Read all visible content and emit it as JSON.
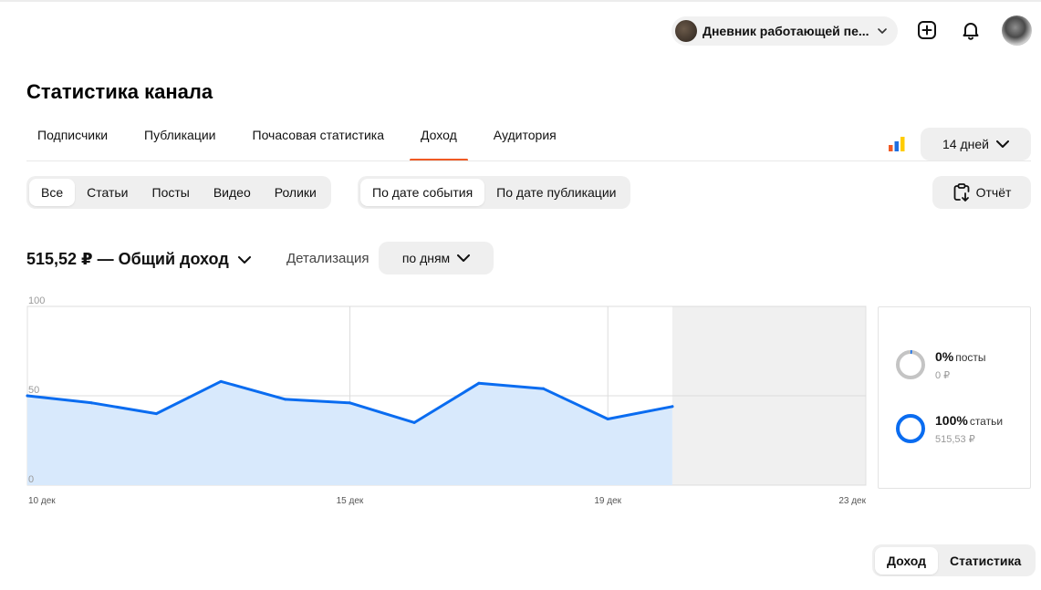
{
  "header": {
    "channel_name": "Дневник работающей пе...",
    "icons": [
      "add-icon",
      "bell-icon"
    ]
  },
  "page_title": "Статистика канала",
  "tabs": [
    {
      "label": "Подписчики",
      "active": false
    },
    {
      "label": "Публикации",
      "active": false
    },
    {
      "label": "Почасовая статистика",
      "active": false
    },
    {
      "label": "Доход",
      "active": true
    },
    {
      "label": "Аудитория",
      "active": false
    }
  ],
  "period": {
    "label": "14 дней"
  },
  "content_filter": [
    {
      "label": "Все",
      "active": true
    },
    {
      "label": "Статьи",
      "active": false
    },
    {
      "label": "Посты",
      "active": false
    },
    {
      "label": "Видео",
      "active": false
    },
    {
      "label": "Ролики",
      "active": false
    }
  ],
  "date_filter": [
    {
      "label": "По дате события",
      "active": true
    },
    {
      "label": "По дате публикации",
      "active": false
    }
  ],
  "report_button": {
    "label": "Отчёт"
  },
  "total": {
    "label": "515,52 ₽ — Общий доход"
  },
  "detail": {
    "label": "Детализация",
    "value": "по дням"
  },
  "chart_data": {
    "type": "area",
    "y_ticks": [
      "100",
      "50",
      "0"
    ],
    "ylim": [
      0,
      100
    ],
    "x_tick_labels": [
      "10 дек",
      "15 дек",
      "19 дек",
      "23 дек"
    ],
    "x_ticks_at_day": [
      10,
      15,
      19,
      23
    ],
    "x_range_days": [
      10,
      23
    ],
    "future_region_from_day": 20,
    "grid": true,
    "color": "#0a6cf0",
    "fill_color": "#d8e9fc",
    "series": [
      {
        "days": [
          10,
          11,
          12,
          13,
          14,
          15,
          16,
          17,
          18,
          19,
          20
        ],
        "values": [
          50,
          46,
          40,
          58,
          48,
          46,
          35,
          57,
          54,
          37,
          44
        ]
      }
    ]
  },
  "legend": [
    {
      "pct": "0%",
      "name": "посты",
      "amount": "0 ₽",
      "fraction": 0,
      "color": "#c4c4c4"
    },
    {
      "pct": "100%",
      "name": "статьи",
      "amount": "515,53 ₽",
      "fraction": 1,
      "color": "#0a6cf0"
    }
  ],
  "bottom_toggle": [
    {
      "label": "Доход",
      "active": true
    },
    {
      "label": "Статистика",
      "active": false
    }
  ],
  "colors": {
    "accent": "#f05a24",
    "chart": "#0a6cf0",
    "pill_bg": "#efefef"
  }
}
